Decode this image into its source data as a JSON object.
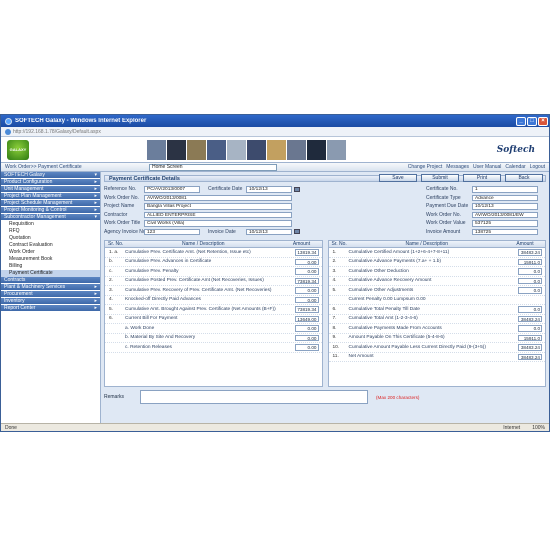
{
  "window": {
    "title": "SOFTECH Galaxy - Windows Internet Explorer",
    "address": "http://192.168.1.78/Galaxy/Default.aspx"
  },
  "banner": {
    "logo_text": "GALAXY",
    "brand": "Softech",
    "photo_colors": [
      "#6b7e9c",
      "#2b3344",
      "#8b7a55",
      "#4a5e86",
      "#a7b4c4",
      "#3d4b6d",
      "#c2a060",
      "#6a7790",
      "#1f2a3c",
      "#8a9ab0"
    ]
  },
  "navbar": {
    "crumb": "Work Order>> Payment Certificate",
    "home_select": "Home Screen",
    "links": [
      "Change Project",
      "Messages",
      "User Manual",
      "Calendar",
      "Logout"
    ]
  },
  "sidebar": {
    "heads": [
      {
        "label": "SOFTECH Galaxy",
        "arrow": "▾"
      }
    ],
    "groups": [
      {
        "label": "Product Configuration",
        "arrow": "▸"
      },
      {
        "label": "Unit Management",
        "arrow": "▸"
      },
      {
        "label": "Project Plan Management",
        "arrow": "▸"
      },
      {
        "label": "Project Schedule Management",
        "arrow": "▸"
      },
      {
        "label": "Project Monitoring & Control",
        "arrow": "▸"
      },
      {
        "label": "Subcontractor Management",
        "arrow": "▾"
      }
    ],
    "items": [
      "Requisition",
      "RFQ",
      "Quotation",
      "Contract Evaluation",
      "Work Order",
      "Measurement Book",
      "Billing",
      "Payment Certificate"
    ],
    "footer_groups": [
      {
        "label": "Contracts",
        "arrow": ""
      },
      {
        "label": "Plant & Machinery Services",
        "arrow": "▸"
      },
      {
        "label": "Procurement",
        "arrow": "▸"
      },
      {
        "label": "Inventory",
        "arrow": "▸"
      },
      {
        "label": "Report Center",
        "arrow": "▸"
      }
    ]
  },
  "panel": {
    "title": "Payment Certificate Details",
    "buttons": [
      "Save",
      "Submit",
      "Print",
      "Back"
    ]
  },
  "form_left": [
    {
      "label": "Reference No.",
      "value": "PC/AV/2013/0007",
      "extra_label": "Certificate Date",
      "extra_value": "10/12/13"
    },
    {
      "label": "Work Order No.",
      "value": "AV/WO/2013/0081"
    },
    {
      "label": "Project Name",
      "value": "Bangla Villas Project"
    },
    {
      "label": "Contractor",
      "value": "ALLIED ENTERPRISE"
    },
    {
      "label": "Work Order Title",
      "value": "Civil Works (Villa)"
    },
    {
      "label": "Agency Invoice No.",
      "value": "123",
      "extra_label": "Invoice Date",
      "extra_value": "10/12/13"
    }
  ],
  "form_right": [
    {
      "label": "Certificate No.",
      "value": "1"
    },
    {
      "label": "Certificate Type",
      "value": "Advance"
    },
    {
      "label": "Payment Due Date",
      "value": "10/12/13"
    },
    {
      "label": "Work Order No.",
      "value": "AV/WO/2013/0081/EW"
    },
    {
      "label": "Work Order Value",
      "value": "537125"
    },
    {
      "label": "Invoice Amount",
      "value": "138725"
    }
  ],
  "table_left": {
    "headers": [
      "Sr. No.",
      "Name / Description",
      "Amount"
    ],
    "rows": [
      {
        "no": "1. a.",
        "desc": "Cumulative Prev. Certificate Amt. (Net Retention, Issue etc)",
        "amount": "13819.34"
      },
      {
        "no": "b.",
        "desc": "Cumulative Prev. Advances in Certificate",
        "amount": "0.00"
      },
      {
        "no": "c.",
        "desc": "Cumulative Prev. Penalty",
        "amount": "0.00"
      },
      {
        "no": "2.",
        "desc": "Cumulative Posted Prev. Certificate Amt (Net Recoveries, Issues)",
        "amount": "73819.34"
      },
      {
        "no": "3.",
        "desc": "Cumulative Prev. Recovery of Prev. Certificate Amt. (Net Recoveries)",
        "amount": "0.00"
      },
      {
        "no": "4.",
        "desc": "Knocked-off Directly Paid Advances",
        "amount": "0.00"
      },
      {
        "no": "5.",
        "desc": "Cumulative Amt. Brought Against Prev. Certificate (Net Amounts (B+F))",
        "amount": "73819.34"
      },
      {
        "no": "6.",
        "desc": "Current Bill For Payment",
        "amount": "13649.00"
      },
      {
        "no": "",
        "desc": "a. Work Done",
        "amount": "0.00"
      },
      {
        "no": "",
        "desc": "b. Material By Site And Recovery",
        "amount": "0.00"
      },
      {
        "no": "",
        "desc": "c. Retention Releases",
        "amount": "0.00"
      }
    ]
  },
  "table_right": {
    "headers": [
      "Sr. No.",
      "Name / Description",
      "Amount"
    ],
    "rows": [
      {
        "no": "1.",
        "desc": "Cumulative Certified Amount (1+2+6-4+7-8+11)",
        "amount": "38483.24"
      },
      {
        "no": "2.",
        "desc": "Cumulative Advance Payments (7.a+ + 1.b)",
        "amount": "15911.0"
      },
      {
        "no": "3.",
        "desc": "Cumulative Other Deduction",
        "amount": "0.0"
      },
      {
        "no": "4.",
        "desc": "Cumulative Advance Recovery Amount",
        "amount": "0.0"
      },
      {
        "no": "5.",
        "desc": "Cumulative Other Adjustments",
        "amount": "0.0"
      },
      {
        "no": "",
        "desc": "Current Penalty   0.00   Lumpsum   0.00",
        "amount": ""
      },
      {
        "no": "6.",
        "desc": "Cumulative Total Penalty Till Date",
        "amount": "0.0"
      },
      {
        "no": "7.",
        "desc": "Cumulative Total Amt (1-2-3-4-6)",
        "amount": "38483.24"
      },
      {
        "no": "8.",
        "desc": "Cumulative Payments Made From Accounts",
        "amount": "0.0"
      },
      {
        "no": "9.",
        "desc": "Amount Payable On This Certificate (5-4-8-6)",
        "amount": "15911.0"
      },
      {
        "no": "10.",
        "desc": "Cumulative Amount Payable Less Current Directly Paid (9-(3+5))",
        "amount": "38483.24"
      },
      {
        "no": "11.",
        "desc": "Net Amount",
        "amount": "38483.24"
      }
    ]
  },
  "remarks": {
    "label": "Remarks",
    "note": "(Max 200 characters)"
  },
  "status": {
    "left": "Done",
    "zone": "Internet",
    "zoom": "100%"
  }
}
